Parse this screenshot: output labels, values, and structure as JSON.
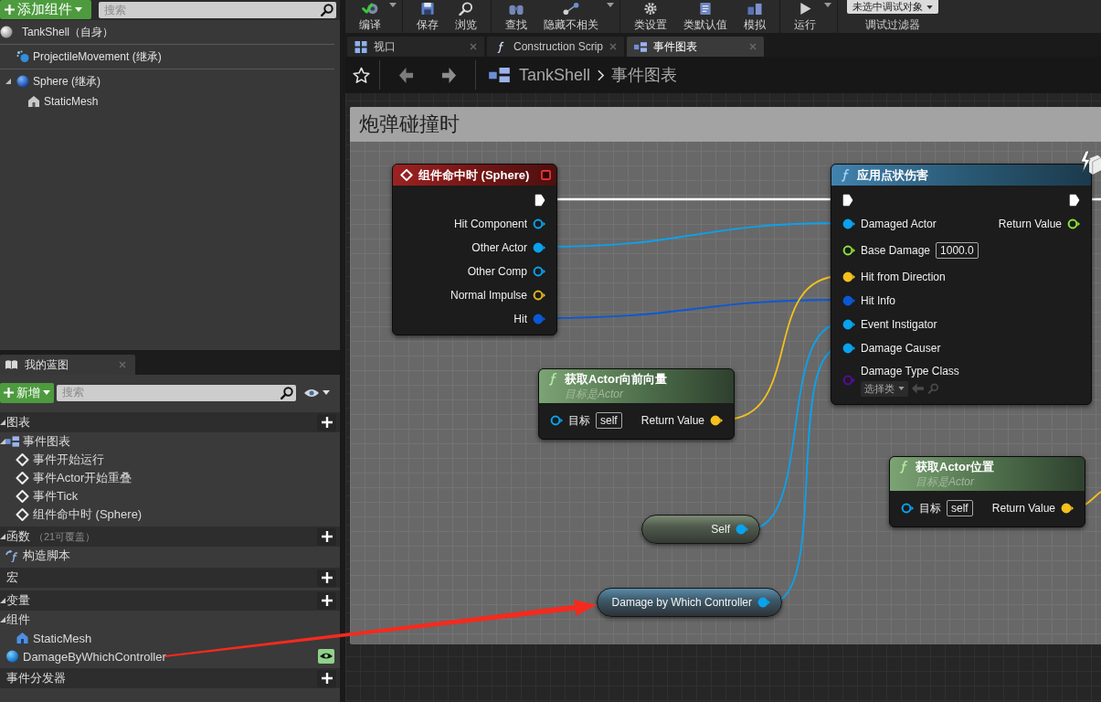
{
  "toolbar": {
    "groups": [
      [
        {
          "label": "编译",
          "kind": "compile",
          "menu": true
        }
      ],
      [
        {
          "label": "保存",
          "kind": "save",
          "menu": false
        },
        {
          "label": "浏览",
          "kind": "browse",
          "menu": false
        }
      ],
      [
        {
          "label": "查找",
          "kind": "find",
          "menu": false
        },
        {
          "label": "隐藏不相关",
          "kind": "hide_unrelated",
          "menu": true
        }
      ],
      [
        {
          "label": "类设置",
          "kind": "class_settings",
          "menu": false
        },
        {
          "label": "类默认值",
          "kind": "class_defaults",
          "menu": false
        },
        {
          "label": "模拟",
          "kind": "simulate",
          "menu": false
        }
      ],
      [
        {
          "label": "运行",
          "kind": "play",
          "menu": true
        }
      ]
    ],
    "debug_filter": {
      "value": "未选中调试对象",
      "label": "调试过滤器"
    }
  },
  "components_panel": {
    "add_button": "添加组件",
    "search": {
      "placeholder": "搜索"
    },
    "tree": [
      {
        "label": "TankShell（自身）",
        "kind": "actor"
      },
      {
        "label": "ProjectileMovement (继承)",
        "kind": "movement"
      },
      {
        "label": "Sphere (继承)",
        "kind": "sphere",
        "expanded": true,
        "children": [
          {
            "label": "StaticMesh",
            "kind": "mesh"
          }
        ]
      }
    ]
  },
  "my_blueprint": {
    "tab": "我的蓝图",
    "add_button": "新增",
    "search": {
      "placeholder": "搜索"
    },
    "sections": [
      {
        "label": "图表",
        "expanded": true,
        "children": [
          {
            "label": "事件图表",
            "kind": "graph",
            "expanded": true,
            "children": [
              {
                "label": "事件开始运行",
                "kind": "event"
              },
              {
                "label": "事件Actor开始重叠",
                "kind": "event"
              },
              {
                "label": "事件Tick",
                "kind": "event"
              },
              {
                "label": "组件命中时 (Sphere)",
                "kind": "event"
              }
            ]
          }
        ]
      },
      {
        "label": "函数",
        "note": "（21可覆盖）",
        "expanded": true,
        "children": [
          {
            "label": "构造脚本",
            "kind": "function"
          }
        ]
      },
      {
        "label": "宏"
      },
      {
        "label": "变量",
        "expanded": true,
        "children": [
          {
            "label": "组件",
            "kind": "category",
            "expanded": true,
            "children": [
              {
                "label": "StaticMesh",
                "kind": "mesh"
              }
            ]
          },
          {
            "label": "DamageByWhichController",
            "kind": "variable",
            "instance_editable": true
          }
        ]
      },
      {
        "label": "事件分发器"
      }
    ]
  },
  "editor_tabs": [
    {
      "label": "视口",
      "kind": "viewport",
      "selected": false
    },
    {
      "label": "Construction Scrip",
      "kind": "function",
      "selected": false
    },
    {
      "label": "事件图表",
      "kind": "graph",
      "selected": true
    }
  ],
  "breadcrumb": [
    "TankShell",
    "事件图表"
  ],
  "graph": {
    "comment": "炮弹碰撞时",
    "nodes": [
      {
        "kind": "event",
        "title": "组件命中时 (Sphere)",
        "exec_out": true,
        "outputs": [
          {
            "label": "Hit Component",
            "color": "#0aa2ee",
            "connected": false
          },
          {
            "label": "Other Actor",
            "color": "#0aa2ee",
            "connected": true
          },
          {
            "label": "Other Comp",
            "color": "#0aa2ee",
            "connected": false
          },
          {
            "label": "Normal Impulse",
            "color": "#e6b520",
            "connected": false
          },
          {
            "label": "Hit",
            "color": "#0b58d6",
            "connected": true
          }
        ]
      },
      {
        "kind": "function",
        "title": "应用点状伤害",
        "authority_only": true,
        "exec_in": true,
        "exec_out": true,
        "inputs": [
          {
            "label": "Damaged Actor",
            "color": "#0aa2ee",
            "connected": true
          },
          {
            "label": "Base Damage",
            "color": "#8fe23a",
            "connected": false,
            "value": "1000.0"
          },
          {
            "label": "Hit from Direction",
            "color": "#f4c01e",
            "connected": true
          },
          {
            "label": "Hit Info",
            "color": "#0b58d6",
            "connected": true
          },
          {
            "label": "Event Instigator",
            "color": "#0aa2ee",
            "connected": true
          },
          {
            "label": "Damage Causer",
            "color": "#0aa2ee",
            "connected": true
          },
          {
            "label": "Damage Type Class",
            "color": "#5a0aa0",
            "connected": false,
            "picker": "选择类"
          }
        ],
        "outputs": [
          {
            "label": "Return Value",
            "color": "#8fe23a",
            "connected": false
          }
        ]
      },
      {
        "kind": "pure",
        "title": "获取Actor向前向量",
        "subtitle": "目标是Actor",
        "inputs": [
          {
            "label": "目标",
            "color": "#0aa2ee",
            "connected": false,
            "value": "self"
          }
        ],
        "outputs": [
          {
            "label": "Return Value",
            "color": "#f4c01e",
            "connected": true
          }
        ]
      },
      {
        "kind": "pure",
        "title": "获取Actor位置",
        "subtitle": "目标是Actor",
        "inputs": [
          {
            "label": "目标",
            "color": "#0aa2ee",
            "connected": false,
            "value": "self"
          }
        ],
        "outputs": [
          {
            "label": "Return Value",
            "color": "#f4c01e",
            "connected": true
          }
        ]
      },
      {
        "kind": "self",
        "title": "Self",
        "outputs": [
          {
            "color": "#0aa2ee",
            "connected": true
          }
        ]
      },
      {
        "kind": "variable",
        "title": "Damage by Which Controller",
        "outputs": [
          {
            "color": "#0aa2ee",
            "connected": true
          }
        ]
      }
    ]
  }
}
